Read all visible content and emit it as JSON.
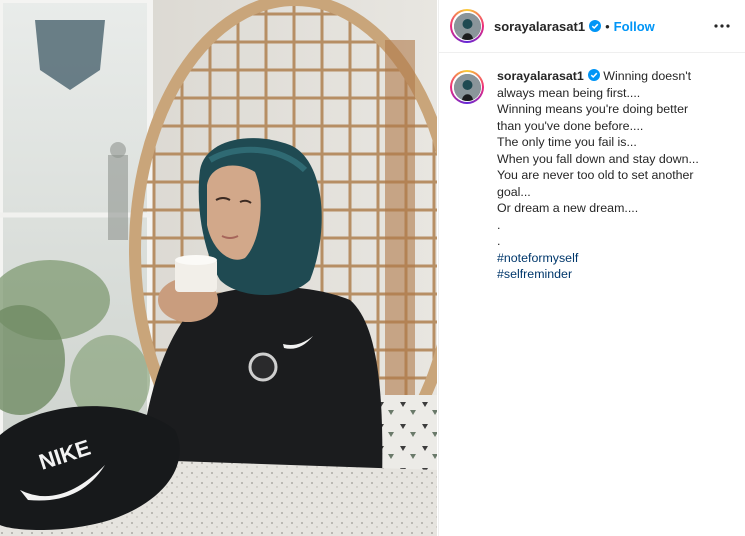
{
  "post": {
    "username": "sorayalarasat1",
    "separator": "•",
    "follow_label": "Follow",
    "verified_color": "#0095f6"
  },
  "caption": {
    "username": "sorayalarasat1",
    "first_line": "Winning doesn't always mean being first....",
    "lines": [
      "Winning means you're doing better",
      "than you've done before....",
      "The only time you fail is...",
      "When you fall down and stay down...",
      "You are never too old to set another",
      "goal...",
      "Or dream a new dream....",
      ".",
      "."
    ],
    "hashtags": [
      "#noteformyself",
      "#selfreminder"
    ]
  },
  "photo": {
    "cap_logo_text": "NIKE"
  },
  "icons": {
    "more": "more-options-icon",
    "verified": "verified-badge-icon"
  }
}
